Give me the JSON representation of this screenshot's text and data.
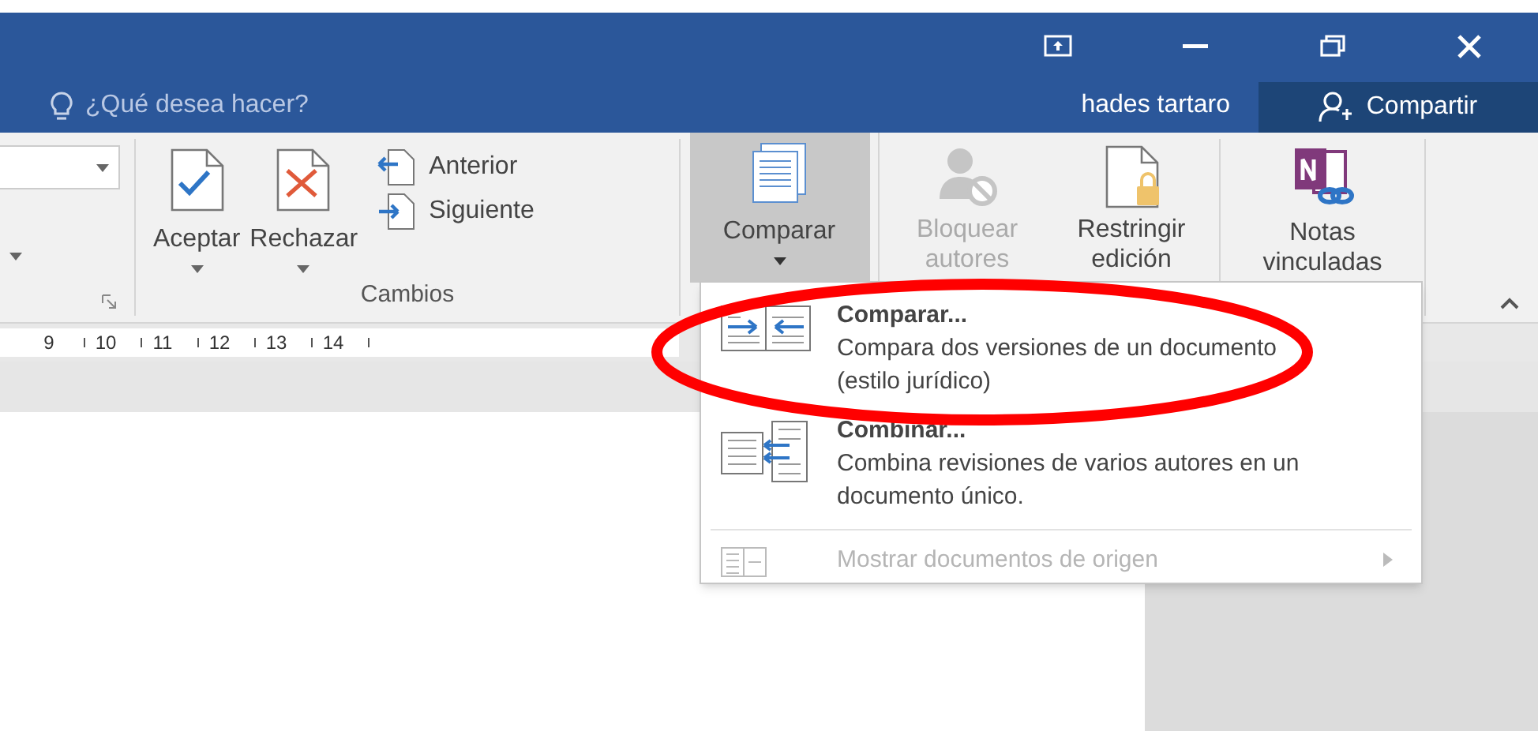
{
  "title_bar": {
    "controls": [
      {
        "kind": "ribbon-display"
      },
      {
        "kind": "minimize"
      },
      {
        "kind": "restore"
      },
      {
        "kind": "close"
      }
    ]
  },
  "tell_me": {
    "placeholder": "¿Qué desea hacer?"
  },
  "user": "hades tartaro",
  "share_button": "Compartir",
  "ribbon": {
    "changes_group": {
      "label": "Cambios",
      "buttons": [
        {
          "label": "Aceptar",
          "kind": "accept"
        },
        {
          "label": "Rechazar",
          "kind": "reject"
        }
      ],
      "nav": [
        {
          "label": "Anterior",
          "kind": "previous"
        },
        {
          "label": "Siguiente",
          "kind": "next"
        }
      ]
    },
    "compare": {
      "label": "Comparar",
      "selected": true
    },
    "protect": [
      {
        "label": "Bloquear autores",
        "kind": "block",
        "disabled": true
      },
      {
        "label": "Restringir edición",
        "kind": "restrict",
        "disabled": false
      }
    ],
    "linked_notes": {
      "label": "Notas vinculadas"
    }
  },
  "ruler": [
    "9",
    "10",
    "11",
    "12",
    "13",
    "14"
  ],
  "compare_menu": [
    {
      "kind": "compare",
      "title": "Comparar...",
      "description": "Compara dos versiones de un documento (estilo jurídico)",
      "disabled": false,
      "submenu": false
    },
    {
      "kind": "combine",
      "title": "Combinar...",
      "description": "Combina revisiones de varios autores en un documento único.",
      "disabled": false,
      "submenu": false
    },
    {
      "kind": "show-sources",
      "title": "Mostrar documentos de origen",
      "disabled": true,
      "submenu": true
    }
  ]
}
